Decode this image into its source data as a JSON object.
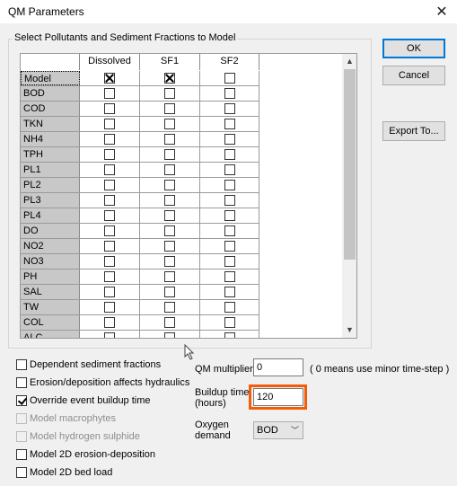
{
  "window": {
    "title": "QM Parameters"
  },
  "group": {
    "title": "Select Pollutants and Sediment Fractions to Model"
  },
  "grid": {
    "columns": [
      "Dissolved",
      "SF1",
      "SF2"
    ],
    "rows": [
      {
        "label": "Model",
        "values": [
          true,
          true,
          false
        ]
      },
      {
        "label": "BOD",
        "values": [
          false,
          false,
          false
        ]
      },
      {
        "label": "COD",
        "values": [
          false,
          false,
          false
        ]
      },
      {
        "label": "TKN",
        "values": [
          false,
          false,
          false
        ]
      },
      {
        "label": "NH4",
        "values": [
          false,
          false,
          false
        ]
      },
      {
        "label": "TPH",
        "values": [
          false,
          false,
          false
        ]
      },
      {
        "label": "PL1",
        "values": [
          false,
          false,
          false
        ]
      },
      {
        "label": "PL2",
        "values": [
          false,
          false,
          false
        ]
      },
      {
        "label": "PL3",
        "values": [
          false,
          false,
          false
        ]
      },
      {
        "label": "PL4",
        "values": [
          false,
          false,
          false
        ]
      },
      {
        "label": "DO",
        "values": [
          false,
          false,
          false
        ]
      },
      {
        "label": "NO2",
        "values": [
          false,
          false,
          false
        ]
      },
      {
        "label": "NO3",
        "values": [
          false,
          false,
          false
        ]
      },
      {
        "label": "PH",
        "values": [
          false,
          false,
          false
        ]
      },
      {
        "label": "SAL",
        "values": [
          false,
          false,
          false
        ]
      },
      {
        "label": "TW",
        "values": [
          false,
          false,
          false
        ]
      },
      {
        "label": "COL",
        "values": [
          false,
          false,
          false
        ]
      },
      {
        "label": "ALC",
        "values": [
          false,
          false,
          false
        ]
      }
    ]
  },
  "buttons": {
    "ok": "OK",
    "cancel": "Cancel",
    "export": "Export To..."
  },
  "options": [
    {
      "label": "Dependent sediment fractions",
      "checked": false,
      "enabled": true
    },
    {
      "label": "Erosion/deposition affects hydraulics",
      "checked": false,
      "enabled": true
    },
    {
      "label": "Override event buildup time",
      "checked": true,
      "enabled": true
    },
    {
      "label": "Model macrophytes",
      "checked": false,
      "enabled": false
    },
    {
      "label": "Model hydrogen sulphide",
      "checked": false,
      "enabled": false
    },
    {
      "label": "Model 2D erosion-deposition",
      "checked": false,
      "enabled": true
    },
    {
      "label": "Model 2D bed load",
      "checked": false,
      "enabled": true
    }
  ],
  "qm_multiplier": {
    "label": "QM multiplier",
    "value": "0",
    "hint": "( 0 means use minor time-step )"
  },
  "buildup_time": {
    "label_line1": "Buildup time",
    "label_line2": "(hours)",
    "value": "120"
  },
  "oxygen_demand": {
    "label_line1": "Oxygen",
    "label_line2": "demand",
    "value": "BOD"
  },
  "colors": {
    "highlight": "#f25c05",
    "ok_border": "#0078d7"
  }
}
